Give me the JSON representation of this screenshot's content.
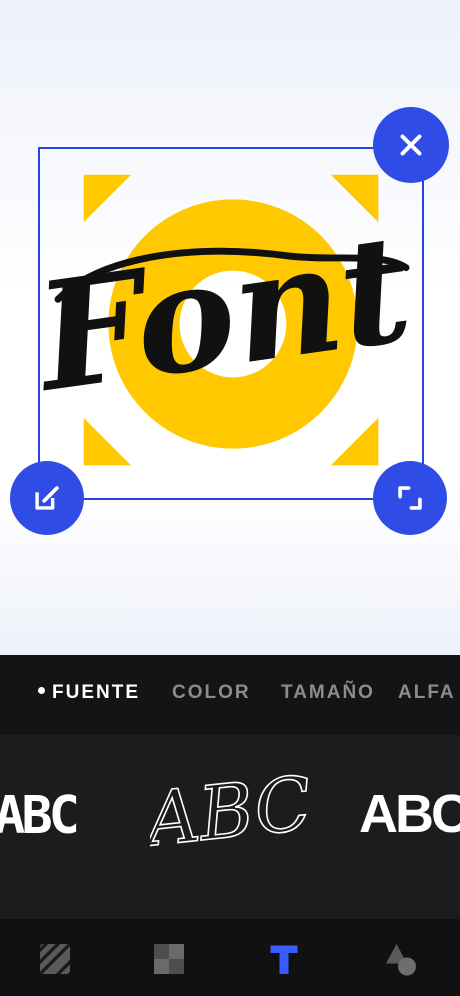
{
  "sticker": {
    "text": "Font",
    "colors": {
      "accent": "#ffc800",
      "text": "#111111",
      "frame": "#2645e0"
    },
    "handles": {
      "close": "close-icon",
      "edit": "edit-icon",
      "resize": "resize-icon"
    }
  },
  "tabs": [
    {
      "label": "FUENTE",
      "active": true
    },
    {
      "label": "COLOR",
      "active": false
    },
    {
      "label": "TAMAÑO",
      "active": false
    },
    {
      "label": "ALFA",
      "active": false
    }
  ],
  "fonts": [
    {
      "sample": "ABC",
      "style": "blocky"
    },
    {
      "sample": "ABC",
      "style": "script"
    },
    {
      "sample": "ABC",
      "style": "bold-geometric"
    }
  ],
  "bottom_nav": [
    {
      "icon": "texture-icon",
      "active": false
    },
    {
      "icon": "grid-icon",
      "active": false
    },
    {
      "icon": "text-icon",
      "active": true
    },
    {
      "icon": "shapes-icon",
      "active": false
    }
  ],
  "brand_color": "#2f4de6"
}
